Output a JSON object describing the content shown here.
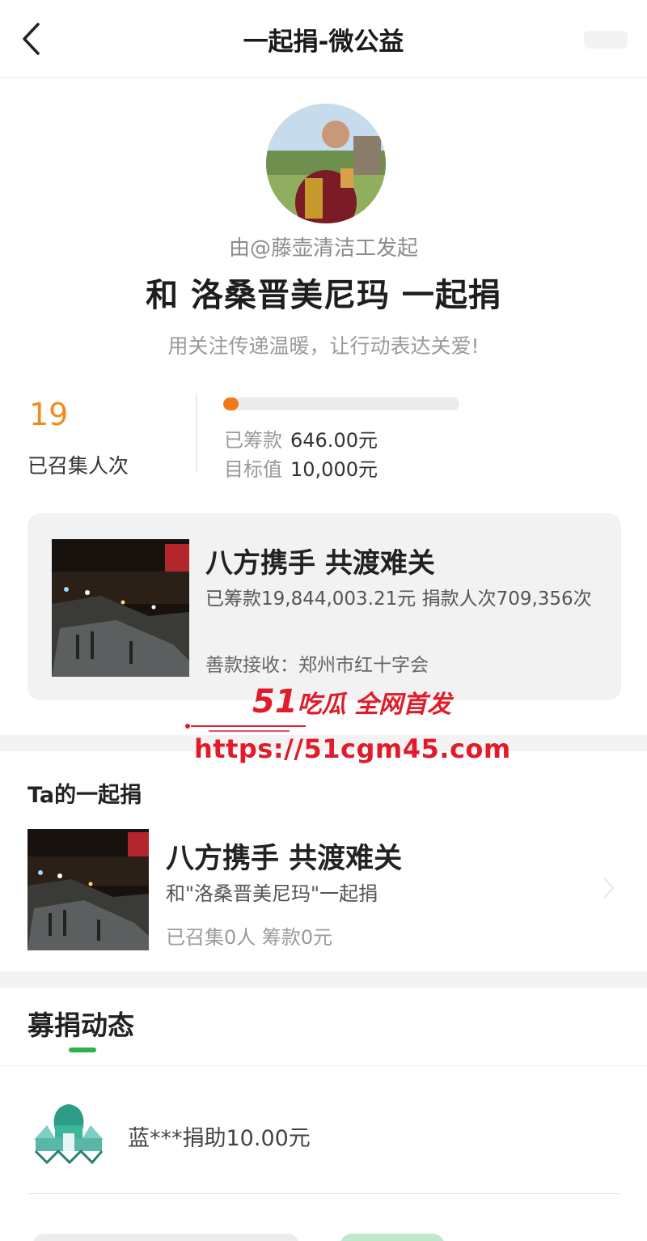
{
  "nav": {
    "title": "一起捐-微公益"
  },
  "initiator": {
    "by_line": "由@藤壶清洁工发起",
    "headline": "和 洛桑晋美尼玛 一起捐",
    "slogan": "用关注传递温暖，让行动表达关爱!"
  },
  "stats": {
    "count": "19",
    "count_label": "已召集人次",
    "progress_fraction": 0.0646,
    "raised_label": "已筹款",
    "raised_value": "646.00元",
    "goal_label": "目标值",
    "goal_value": "10,000元"
  },
  "project": {
    "title": "八方携手 共渡难关",
    "stats_line": "已筹款19,844,003.21元  捐款人次709,356次",
    "receiver": "善款接收：郑州市红十字会"
  },
  "watermark": {
    "brand_num": "51",
    "brand_text": "吃瓜 全网首发",
    "url": "https://51cgm45.com"
  },
  "ta_section": {
    "title": "Ta的一起捐",
    "item_title": "八方携手 共渡难关",
    "item_with": "和\"洛桑晋美尼玛\"一起捐",
    "item_stats": "已召集0人  筹款0元"
  },
  "feed": {
    "tab_label": "募捐动态",
    "items": [
      {
        "text": "蓝***捐助10.00元"
      }
    ]
  },
  "colors": {
    "accent_orange": "#f08c1e",
    "progress": "#f07a18",
    "green": "#2fb14a",
    "watermark_red": "#e01b2a"
  }
}
